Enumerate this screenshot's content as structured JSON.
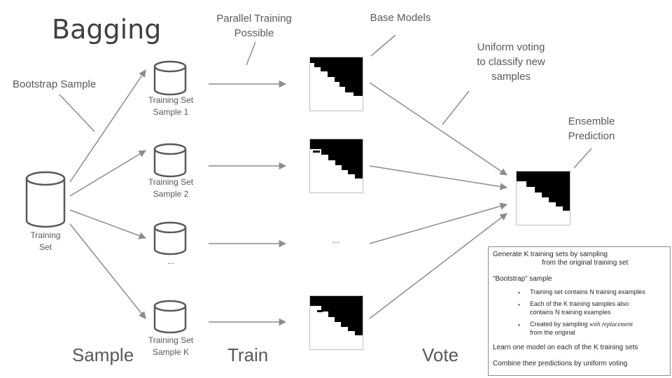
{
  "title": "Bagging",
  "annotations": {
    "bootstrap_sample": "Bootstrap Sample",
    "parallel_training": [
      "Parallel Training",
      "Possible"
    ],
    "base_models": "Base Models",
    "uniform_voting": [
      "Uniform voting",
      "to classify new",
      "samples"
    ],
    "ensemble_prediction": [
      "Ensemble",
      "Prediction"
    ]
  },
  "training_set": {
    "label": [
      "Training",
      "Set"
    ]
  },
  "samples": [
    {
      "label": [
        "Training Set",
        "Sample 1"
      ]
    },
    {
      "label": [
        "Training Set",
        "Sample 2"
      ]
    },
    {
      "label": [
        "..."
      ]
    },
    {
      "label": [
        "Training Set",
        "Sample K"
      ]
    }
  ],
  "models_ellipsis": "...",
  "stages": {
    "sample": "Sample",
    "train": "Train",
    "vote": "Vote"
  },
  "panel": {
    "line1a": "Generate K training sets by sampling",
    "line1b": "from the original training set",
    "bootstrap_heading": "“Bootstrap” sample",
    "bullets": [
      {
        "text": [
          "Training set contains N training examples"
        ]
      },
      {
        "text": [
          "Each of the K training samples also",
          "contains N training examples"
        ]
      },
      {
        "text_prefix": "Created by sampling ",
        "text_em": "with replacement",
        "text_after": "from the original"
      }
    ],
    "learn": "Learn one model on each of the K training sets",
    "combine": "Combine their predictions by uniform voting"
  },
  "colors": {
    "arrow": "#8c8c8c",
    "text": "#595959",
    "model_fill": "#000000"
  }
}
